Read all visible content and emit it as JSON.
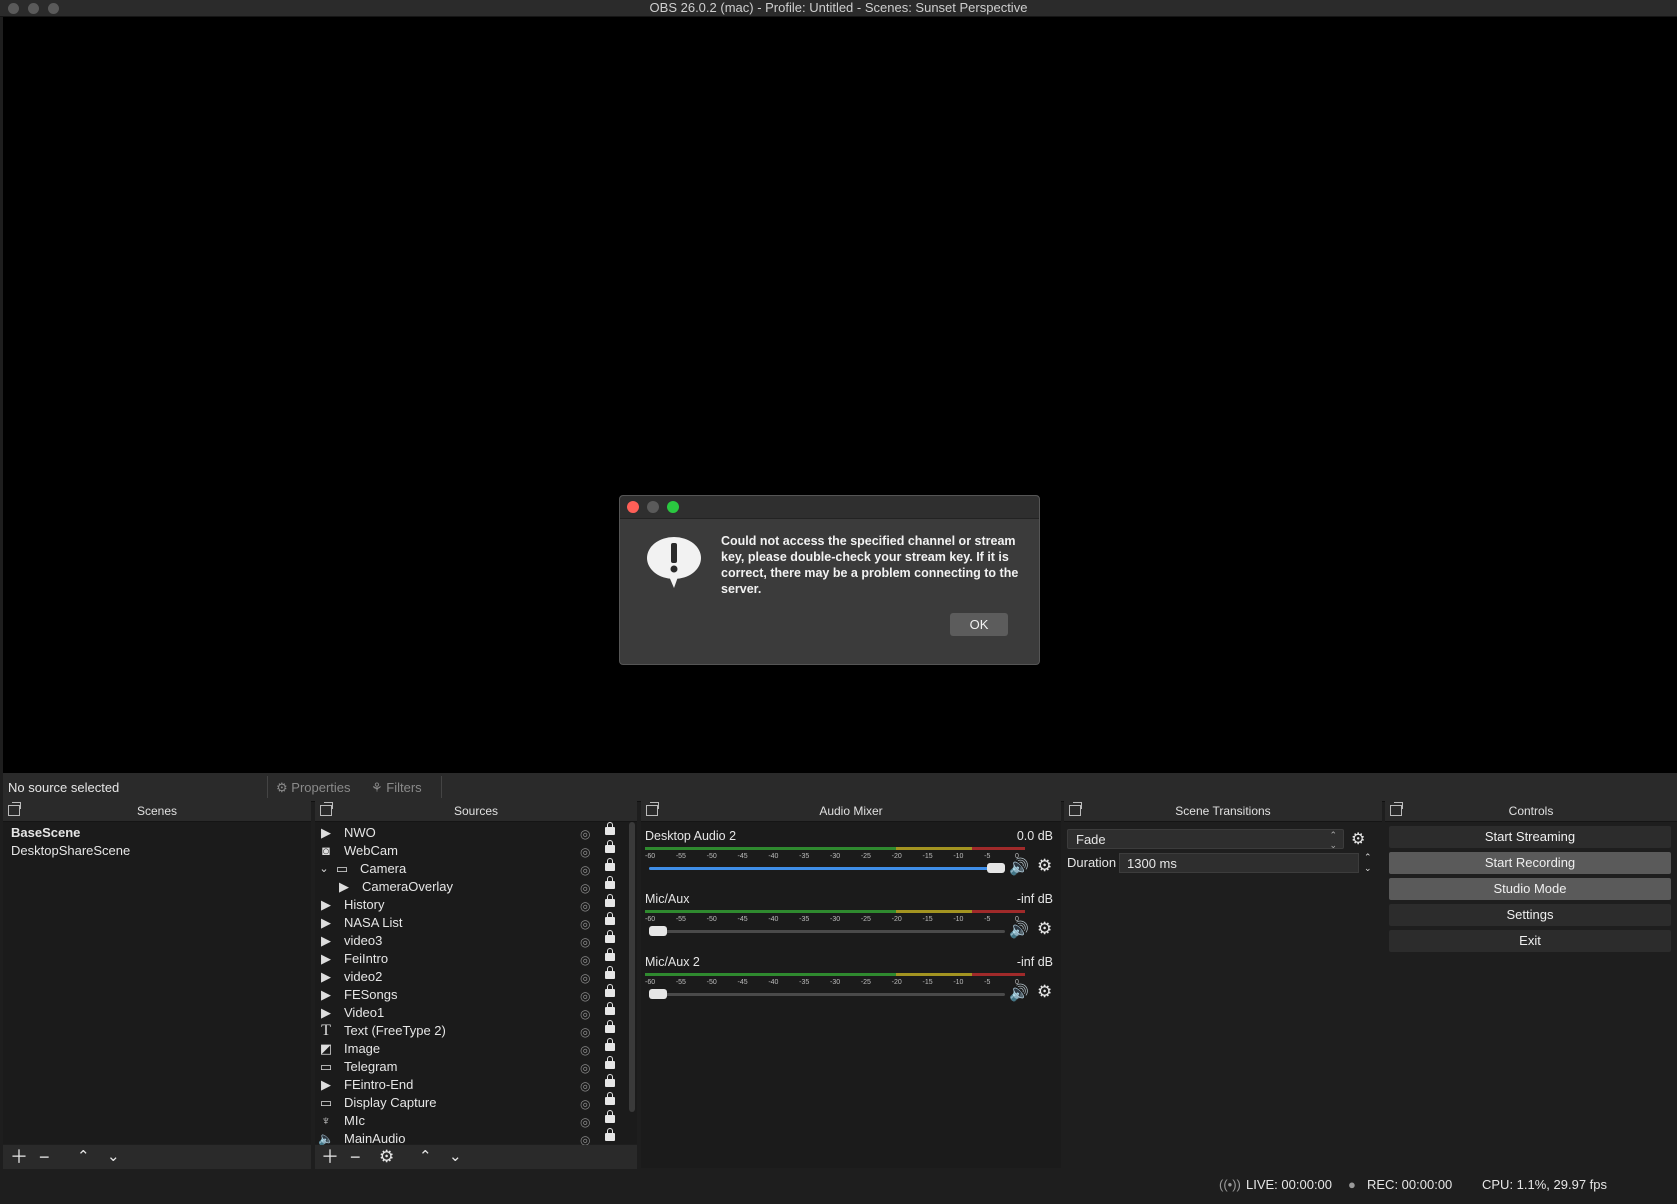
{
  "window": {
    "title": "OBS 26.0.2 (mac) - Profile: Untitled - Scenes: Sunset Perspective"
  },
  "dialog": {
    "message": "Could not access the specified channel or stream key, please double-check your stream key. If it is correct, there may be a problem connecting to the server.",
    "ok_label": "OK",
    "colors": {
      "close": "#fe5f57",
      "minimize": "#5a5a5a",
      "zoom": "#2ac840"
    }
  },
  "propbar": {
    "no_source": "No source selected",
    "properties_label": "Properties",
    "filters_label": "Filters"
  },
  "scenes": {
    "header": "Scenes",
    "items": [
      {
        "label": "BaseScene",
        "selected": true
      },
      {
        "label": "DesktopShareScene",
        "selected": false
      }
    ]
  },
  "sources": {
    "header": "Sources",
    "items": [
      {
        "label": "NWO",
        "icon": "play-icon",
        "glyph": "▶",
        "indent": 0
      },
      {
        "label": "WebCam",
        "icon": "camera-icon",
        "glyph": "◙",
        "indent": 0
      },
      {
        "label": "Camera",
        "icon": "folder-icon",
        "glyph": "▭",
        "indent": 1,
        "expander": "⌄"
      },
      {
        "label": "CameraOverlay",
        "icon": "play-icon",
        "glyph": "▶",
        "indent": 2
      },
      {
        "label": "History",
        "icon": "play-icon",
        "glyph": "▶",
        "indent": 0
      },
      {
        "label": "NASA List",
        "icon": "play-icon",
        "glyph": "▶",
        "indent": 0
      },
      {
        "label": "video3",
        "icon": "play-icon",
        "glyph": "▶",
        "indent": 0
      },
      {
        "label": "FeiIntro",
        "icon": "play-icon",
        "glyph": "▶",
        "indent": 0
      },
      {
        "label": "video2",
        "icon": "play-icon",
        "glyph": "▶",
        "indent": 0
      },
      {
        "label": "FESongs",
        "icon": "play-icon",
        "glyph": "▶",
        "indent": 0
      },
      {
        "label": "Video1",
        "icon": "play-icon",
        "glyph": "▶",
        "indent": 0
      },
      {
        "label": "Text (FreeType 2)",
        "icon": "text-icon",
        "glyph": "T",
        "indent": 0
      },
      {
        "label": "Image",
        "icon": "image-icon",
        "glyph": "◩",
        "indent": 0
      },
      {
        "label": "Telegram",
        "icon": "window-icon",
        "glyph": "▭",
        "indent": 0
      },
      {
        "label": "FEintro-End",
        "icon": "play-icon",
        "glyph": "▶",
        "indent": 0
      },
      {
        "label": "Display Capture",
        "icon": "monitor-icon",
        "glyph": "▭",
        "indent": 0
      },
      {
        "label": "MIc",
        "icon": "microphone-icon",
        "glyph": "♆",
        "indent": 0
      },
      {
        "label": "MainAudio",
        "icon": "speaker-icon",
        "glyph": "🔈",
        "indent": 0
      }
    ]
  },
  "audio": {
    "header": "Audio Mixer",
    "ticks": [
      "-60",
      "-55",
      "-50",
      "-45",
      "-40",
      "-35",
      "-30",
      "-25",
      "-20",
      "-15",
      "-10",
      "-5",
      "0"
    ],
    "channels": [
      {
        "name": "Desktop Audio 2",
        "db": "0.0 dB",
        "volume": 1.0
      },
      {
        "name": "Mic/Aux",
        "db": "-inf dB",
        "volume": 0.0
      },
      {
        "name": "Mic/Aux 2",
        "db": "-inf dB",
        "volume": 0.0
      }
    ],
    "colors": {
      "green": "#2f8a2f",
      "yellow": "#a39421",
      "red": "#a02a2a",
      "slider": "#3f8ee8"
    }
  },
  "transitions": {
    "header": "Scene Transitions",
    "selected": "Fade",
    "duration_label": "Duration",
    "duration_value": "1300 ms"
  },
  "controls": {
    "header": "Controls",
    "start_streaming": "Start Streaming",
    "start_recording": "Start Recording",
    "studio_mode": "Studio Mode",
    "settings": "Settings",
    "exit": "Exit"
  },
  "status": {
    "live": "LIVE: 00:00:00",
    "rec": "REC: 00:00:00",
    "cpu": "CPU: 1.1%, 29.97 fps"
  }
}
